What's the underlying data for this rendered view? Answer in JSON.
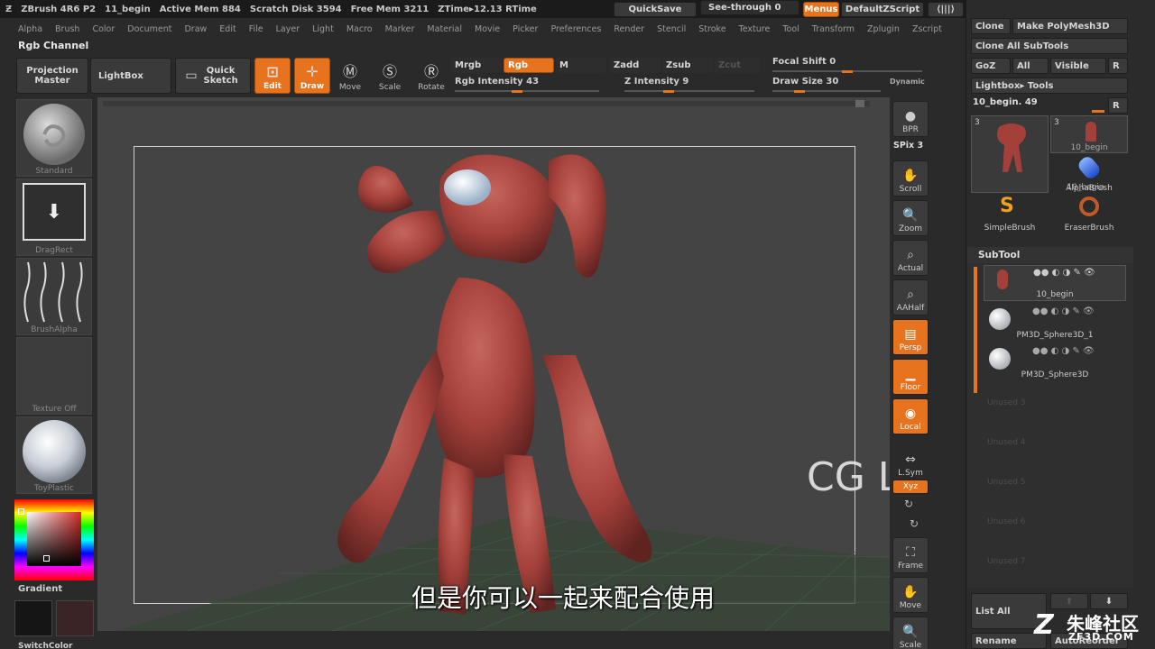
{
  "title_bar": {
    "app": "ZBrush 4R6 P2",
    "doc": "11_begin",
    "active_mem": "Active Mem 884",
    "scratch": "Scratch Disk 3594",
    "free_mem": "Free Mem 3211",
    "ztime": "ZTime▸12.13 RTime",
    "quicksave": "QuickSave",
    "see_through": "See-through 0",
    "menus": "Menus",
    "zscript": "DefaultZScript"
  },
  "menu": [
    "Alpha",
    "Brush",
    "Color",
    "Document",
    "Draw",
    "Edit",
    "File",
    "Layer",
    "Light",
    "Macro",
    "Marker",
    "Material",
    "Movie",
    "Picker",
    "Preferences",
    "Render",
    "Stencil",
    "Stroke",
    "Texture",
    "Tool",
    "Transform",
    "Zplugin",
    "Zscript"
  ],
  "tooltip_title": "Rgb Channel",
  "toolbar": {
    "projection_master": "Projection Master",
    "lightbox": "LightBox",
    "quick_sketch": "Quick Sketch",
    "edit": "Edit",
    "draw": "Draw",
    "move": "Move",
    "scale": "Scale",
    "rotate": "Rotate",
    "mrgb": "Mrgb",
    "rgb": "Rgb",
    "m": "M",
    "zadd": "Zadd",
    "zsub": "Zsub",
    "zcut": "Zcut",
    "rgb_intensity": "Rgb Intensity 43",
    "z_intensity": "Z Intensity 9",
    "focal_shift": "Focal Shift 0",
    "draw_size": "Draw Size 30",
    "dynamic": "Dynamic",
    "rgb_intensity_value": 43,
    "z_intensity_value": 9,
    "draw_size_value": 30
  },
  "left_shelf": {
    "brush": "Standard",
    "stroke": "DragRect",
    "alpha": "BrushAlpha",
    "texture": "Texture Off",
    "material": "ToyPlastic",
    "gradient": "Gradient",
    "switch_color": "SwitchColor"
  },
  "right_shelf": {
    "bpr": "BPR",
    "spix": "SPix 3",
    "scroll": "Scroll",
    "zoom": "Zoom",
    "actual": "Actual",
    "aahalf": "AAHalf",
    "persp": "Persp",
    "floor": "Floor",
    "local": "Local",
    "lsym": "L.Sym",
    "xyz": "Xyz",
    "frame": "Frame",
    "move": "Move",
    "scale": "Scale"
  },
  "tool_palette": {
    "clone": "Clone",
    "make_polymesh": "Make PolyMesh3D",
    "clone_all": "Clone All SubTools",
    "goz": "GoZ",
    "all": "All",
    "visible": "Visible",
    "r": "R",
    "lightbox_tools": "Lightbox▸ Tools",
    "current_tool": "10_begin. 49",
    "tools": [
      {
        "label": "10_begin",
        "count": "3"
      },
      {
        "label": "10_begin",
        "count": "3"
      },
      {
        "label": "AlphaBrush",
        "count": ""
      },
      {
        "label": "SimpleBrush",
        "count": ""
      },
      {
        "label": "EraserBrush",
        "count": ""
      }
    ]
  },
  "subtool": {
    "header": "SubTool",
    "items": [
      "10_begin",
      "PM3D_Sphere3D_1",
      "PM3D_Sphere3D"
    ],
    "unused": [
      "Unused 3",
      "Unused 4",
      "Unused 5",
      "Unused 6",
      "Unused 7"
    ],
    "list_all": "List All",
    "rename": "Rename",
    "autoreorder": "AutoReorder"
  },
  "watermark": "CG Library",
  "subtitle": "但是你可以一起来配合使用",
  "logo": {
    "cn": "朱峰社区",
    "url": "ZF3D.COM"
  },
  "colors": {
    "accent": "#e8731e",
    "model": "#a5403a"
  }
}
